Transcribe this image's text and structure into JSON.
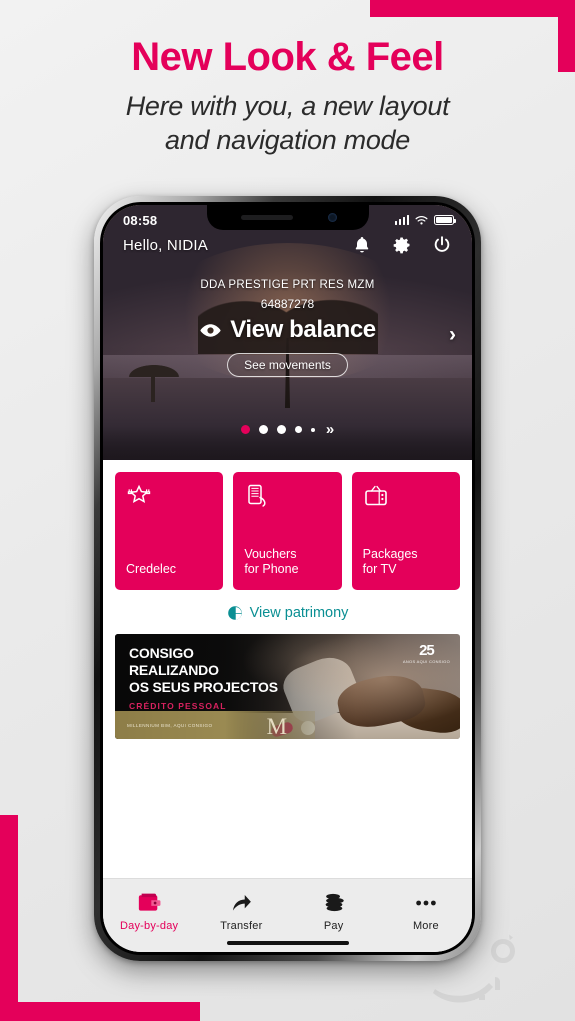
{
  "promo": {
    "headline": "New Look & Feel",
    "subhead_line1": "Here with you, a new layout",
    "subhead_line2": "and navigation mode",
    "accent_color": "#e4005a"
  },
  "phone": {
    "statusbar": {
      "time": "08:58",
      "signal_icon": "signal-bars-icon",
      "wifi_icon": "wifi-icon",
      "battery_icon": "battery-full-icon"
    },
    "header": {
      "greeting": "Hello, NIDIA",
      "icons": [
        {
          "name": "notifications-bell-icon",
          "label": "Notifications"
        },
        {
          "name": "settings-gear-icon",
          "label": "Settings"
        },
        {
          "name": "power-logout-icon",
          "label": "Logout"
        }
      ]
    },
    "account": {
      "name": "DDA PRESTIGE PRT RES MZM",
      "number": "64887278",
      "balance_label": "View balance",
      "eye_icon": "eye-icon",
      "movements_button": "See movements",
      "next_arrow": "›",
      "carousel_more": "»",
      "carousel_dots": 5,
      "carousel_active_index": 0
    },
    "tiles": [
      {
        "label": "Credelec",
        "icon": "credelec-star-plug-icon"
      },
      {
        "label": "Vouchers\nfor Phone",
        "label_line1": "Vouchers",
        "label_line2": "for Phone",
        "icon": "mobile-phone-hand-icon"
      },
      {
        "label": "Packages\nfor TV",
        "label_line1": "Packages",
        "label_line2": "for TV",
        "icon": "television-icon"
      }
    ],
    "patrimony": {
      "label": "View patrimony",
      "icon": "pie-chart-icon",
      "color": "#0a8f93"
    },
    "banner": {
      "line1": "CONSIGO",
      "line2": "REALIZANDO",
      "line3": "OS SEUS PROJECTOS",
      "subtitle": "CRÉDITO PESSOAL",
      "badge_number": "25",
      "badge_caption": "ANOS AQUI CONSIGO",
      "goldbar_text": "MILLENNIUM BIM, AQUI CONSIGO",
      "logo_letter": "M"
    },
    "bottom_nav": [
      {
        "label": "Day-by-day",
        "icon": "wallet-icon",
        "active": true
      },
      {
        "label": "Transfer",
        "icon": "transfer-arrow-icon",
        "active": false
      },
      {
        "label": "Pay",
        "icon": "coins-stack-icon",
        "active": false
      },
      {
        "label": "More",
        "icon": "more-dots-icon",
        "active": false
      }
    ]
  }
}
